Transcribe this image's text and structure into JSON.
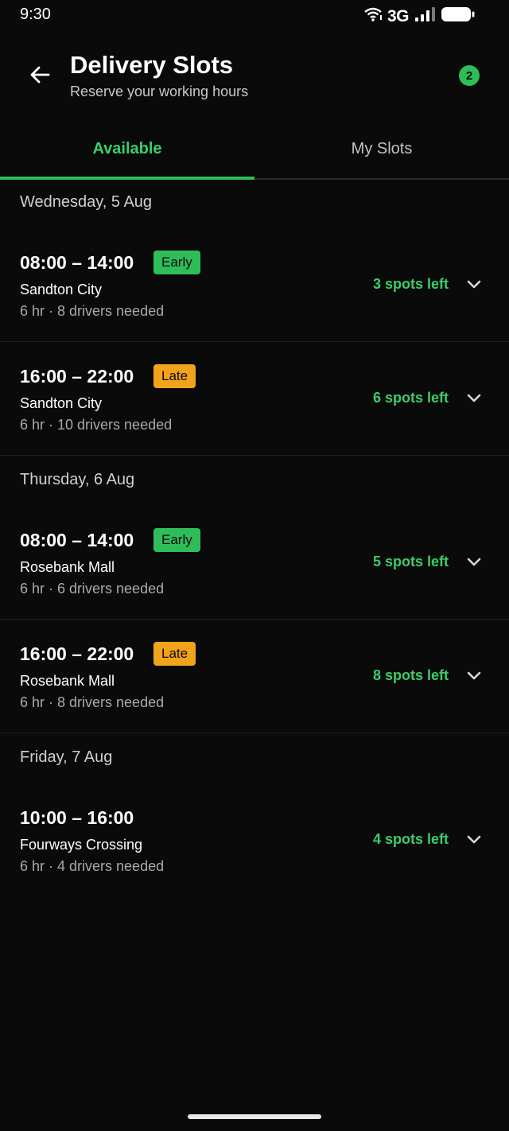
{
  "status_bar": {
    "time": "9:30",
    "network": "3G"
  },
  "header": {
    "title": "Delivery Slots",
    "subtitle": "Reserve your working hours",
    "badge_count": "2"
  },
  "tabs": [
    {
      "label": "Available",
      "active": true
    },
    {
      "label": "My Slots",
      "active": false
    }
  ],
  "days": [
    {
      "label": "Wednesday, 5 Aug",
      "slots": [
        {
          "time": "08:00 – 14:00",
          "tag": "Early",
          "location": "Sandton City",
          "meta": "6 hr · 8 drivers needed",
          "spots": "3 spots left"
        },
        {
          "time": "16:00 – 22:00",
          "tag": "Late",
          "location": "Sandton City",
          "meta": "6 hr · 10 drivers needed",
          "spots": "6 spots left"
        }
      ]
    },
    {
      "label": "Thursday, 6 Aug",
      "slots": [
        {
          "time": "08:00 – 14:00",
          "tag": "Early",
          "location": "Rosebank Mall",
          "meta": "6 hr · 6 drivers needed",
          "spots": "5 spots left"
        },
        {
          "time": "16:00 – 22:00",
          "tag": "Late",
          "location": "Rosebank Mall",
          "meta": "6 hr · 8 drivers needed",
          "spots": "8 spots left"
        }
      ]
    },
    {
      "label": "Friday, 7 Aug",
      "slots": [
        {
          "time": "10:00 – 16:00",
          "location": "Fourways Crossing",
          "meta": "6 hr · 4 drivers needed",
          "spots": "4 spots left"
        }
      ]
    }
  ],
  "colors": {
    "background": "#0a0a0b",
    "accent_green": "#2ebd59",
    "late_orange": "#f2a31c"
  }
}
